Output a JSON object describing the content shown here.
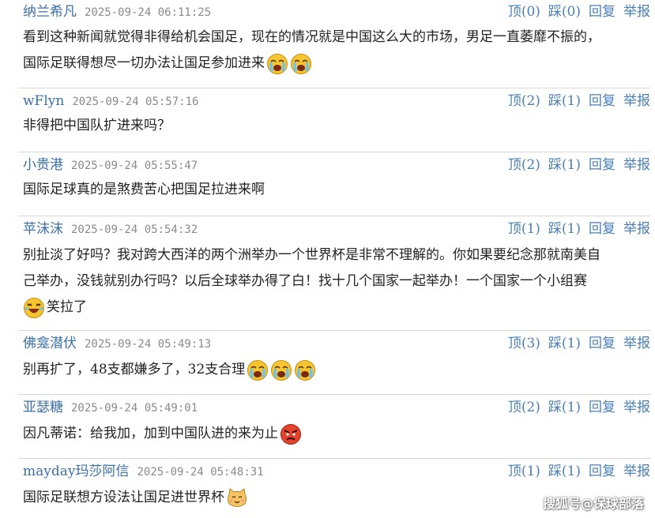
{
  "actions": {
    "up": "顶",
    "down": "踩",
    "reply": "回复",
    "report": "举报"
  },
  "comments": [
    {
      "user": "纳兰希凡",
      "time": "2025-09-24 06:11:25",
      "up": "(0)",
      "down": "(0)",
      "lines": [
        "看到这种新闻就觉得非得给机会国足，现在的情况就是中国这么大的市场，男足一直萎靡不振的，",
        "国际足联得想尽一切办法让国足参加进来"
      ],
      "emojis": [
        "crying-emoji",
        "crying-emoji"
      ]
    },
    {
      "user": "wFlyn",
      "time": "2025-09-24 05:57:16",
      "up": "(2)",
      "down": "(1)",
      "lines": [
        "非得把中国队扩进来吗？"
      ],
      "emojis": []
    },
    {
      "user": "小贵港",
      "time": "2025-09-24 05:55:47",
      "up": "(2)",
      "down": "(1)",
      "lines": [
        "国际足球真的是煞费苦心把国足拉进来啊"
      ],
      "emojis": []
    },
    {
      "user": "苹沫沫",
      "time": "2025-09-24 05:54:32",
      "up": "(1)",
      "down": "(1)",
      "lines": [
        "别扯淡了好吗？我对跨大西洋的两个洲举办一个世界杯是非常不理解的。你如果要纪念那就南美自",
        "己举办，没钱就别办行吗？以后全球举办得了白！找十几个国家一起举办！一个国家一个小组赛",
        "笑拉了"
      ],
      "emojis": [
        "laughing-emoji"
      ]
    },
    {
      "user": "佛龛潜伏",
      "time": "2025-09-24 05:49:13",
      "up": "(3)",
      "down": "(1)",
      "lines": [
        "别再扩了，48支都嫌多了，32支合理"
      ],
      "emojis": [
        "crying-emoji",
        "crying-emoji",
        "crying-emoji"
      ]
    },
    {
      "user": "亚瑟糖",
      "time": "2025-09-24 05:49:01",
      "up": "(2)",
      "down": "(1)",
      "lines": [
        "因凡蒂诺：给我加，加到中国队进的来为止"
      ],
      "emojis": [
        "angry-emoji"
      ]
    },
    {
      "user": "mayday玛莎阿信",
      "time": "2025-09-24 05:48:31",
      "up": "(1)",
      "down": "(1)",
      "lines": [
        "国际足联想方设法让国足进世界杯"
      ],
      "emojis": [
        "cat-emoji"
      ]
    }
  ],
  "watermark": "搜狐号@保球部落"
}
